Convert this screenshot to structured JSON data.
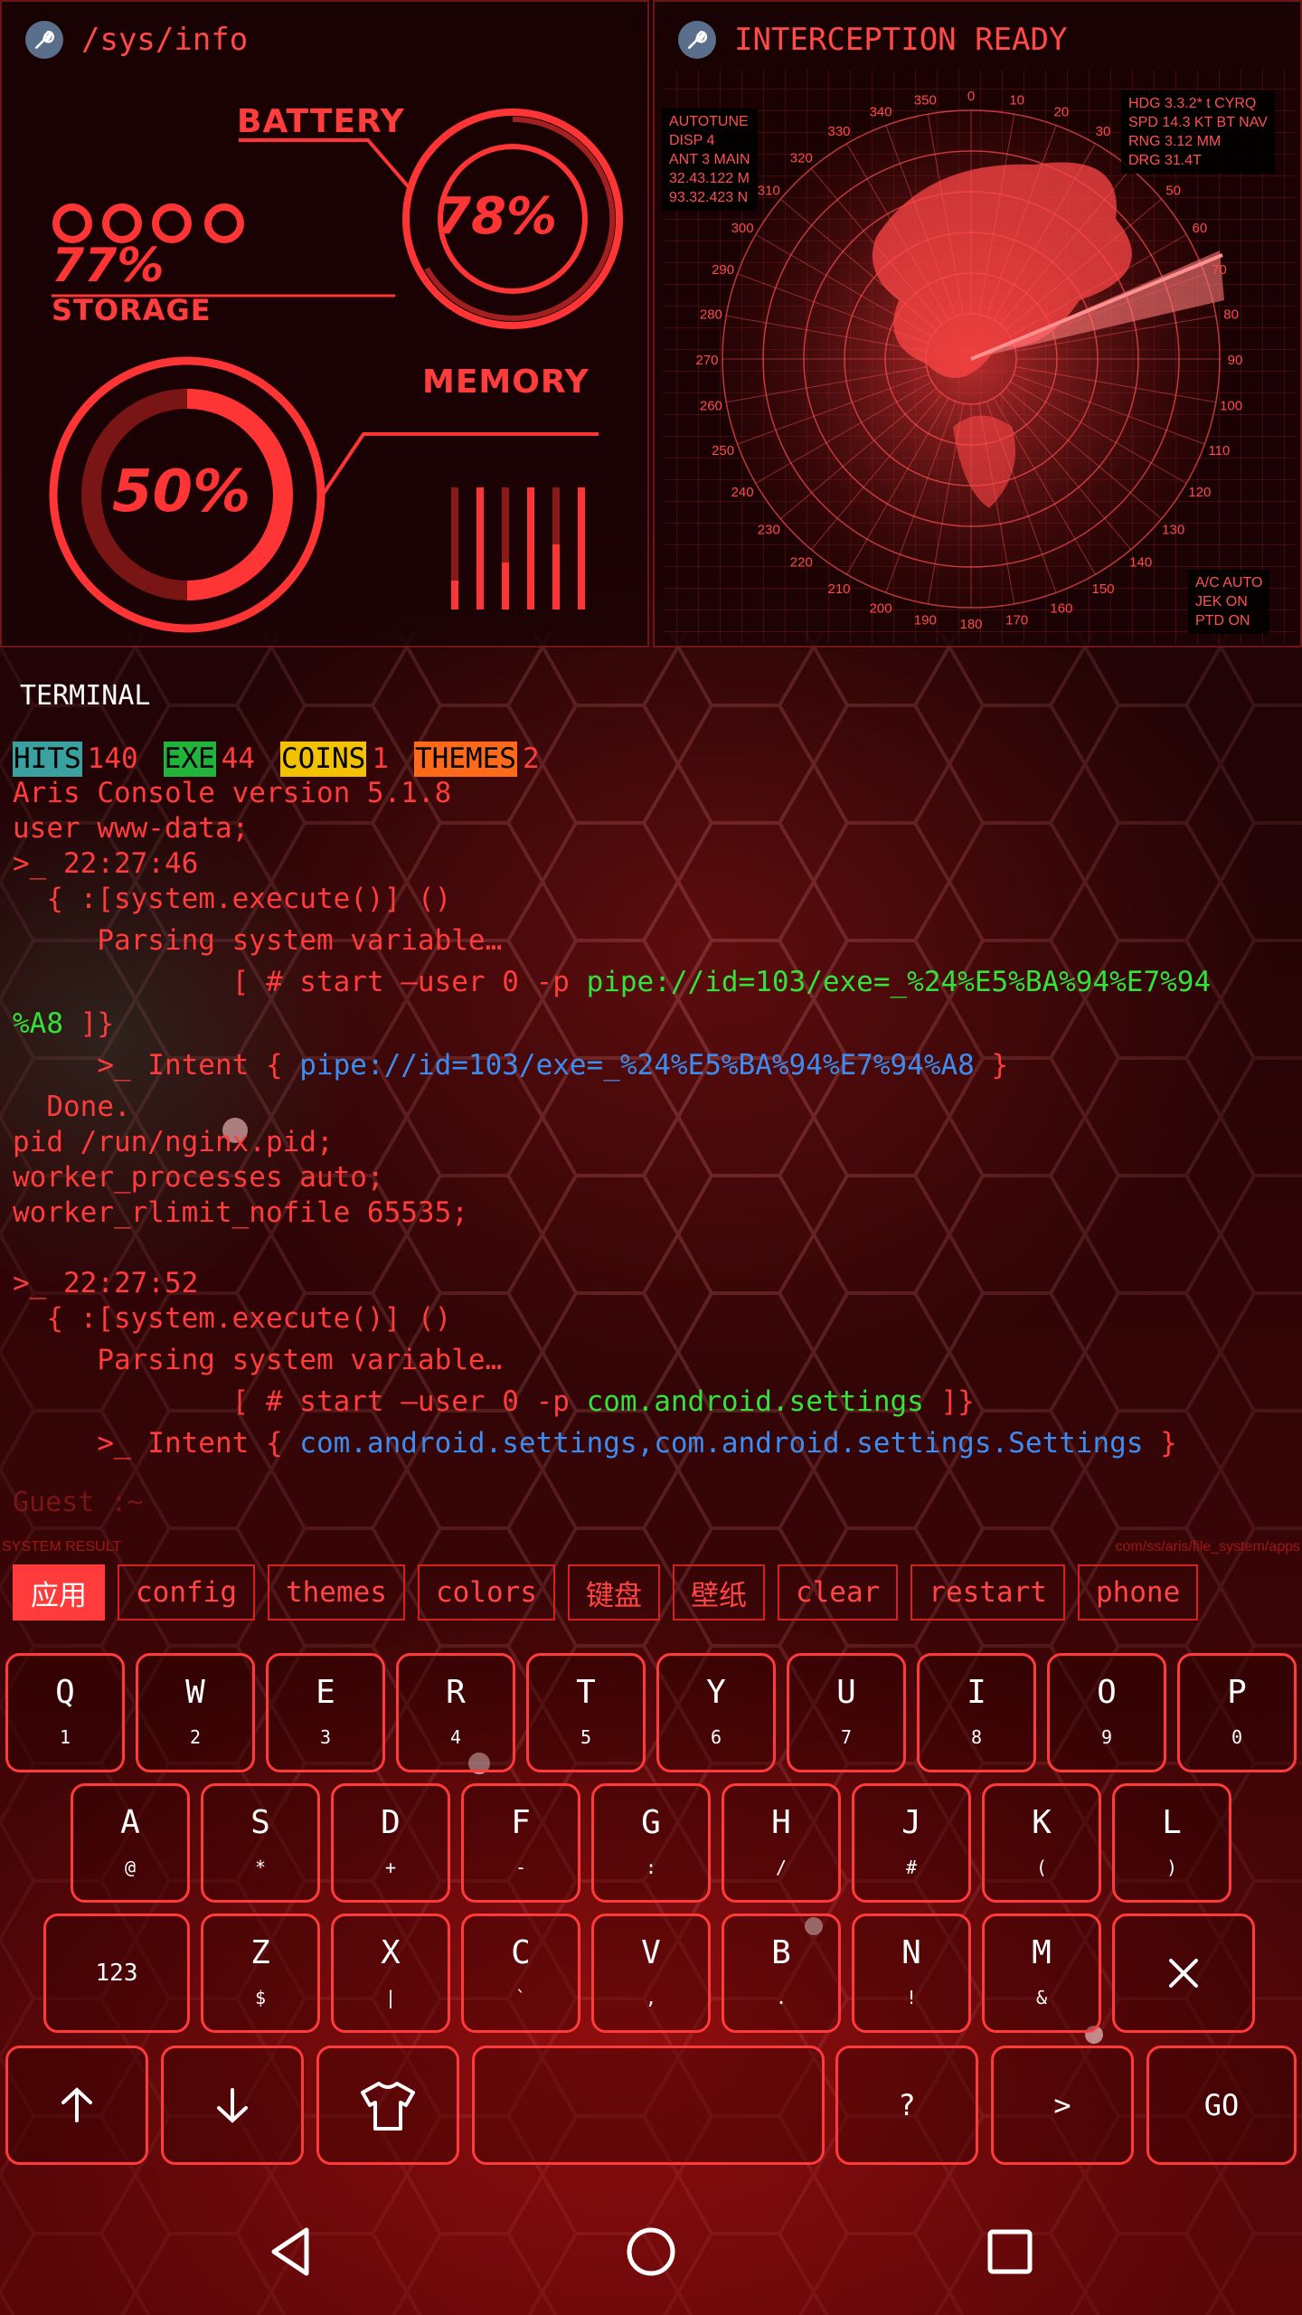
{
  "sys_panel": {
    "path": "/sys/info",
    "battery_label": "BATTERY",
    "battery_value": "78%",
    "battery_level": 0.78,
    "storage_value": "77%",
    "storage_label": "STORAGE",
    "memory_label": "MEMORY",
    "memory_value": "50%",
    "memory_level": 0.5
  },
  "radar_panel": {
    "title": "INTERCEPTION READY",
    "info_topleft": "AUTOTUNE\nDISP 4\nANT 3 MAIN\n32.43.122 M\n93.32.423 N",
    "info_topright": "HDG 3.3.2* t CYRQ\nSPD 14.3 KT BT NAV\nRNG 3.12 MM\nDRG 31.4T",
    "info_bottomright": "A/C AUTO\nJEK ON\nPTD ON",
    "bearings": [
      "350",
      "0",
      "10",
      "20",
      "30",
      "40",
      "50",
      "60",
      "70",
      "80",
      "90",
      "100",
      "110",
      "120",
      "130",
      "140",
      "150",
      "160",
      "170",
      "180",
      "190",
      "200",
      "210",
      "220",
      "230",
      "240",
      "250",
      "260",
      "270",
      "280",
      "290",
      "300",
      "310",
      "320",
      "330",
      "340"
    ]
  },
  "terminal": {
    "title": "TERMINAL",
    "stats": [
      {
        "tag": "HITS",
        "value": "140",
        "color": "#3aa0a0"
      },
      {
        "tag": "EXE",
        "value": "44",
        "color": "#22b33a"
      },
      {
        "tag": "COINS",
        "value": "1",
        "color": "#f2c200"
      },
      {
        "tag": "THEMES",
        "value": "2",
        "color": "#ff6a1a"
      }
    ],
    "line1": "Aris Console version 5.1.8",
    "line2": "user www-data;",
    "line3": ">_ 22:27:46",
    "line4": "  { :[system.execute()] ()",
    "line5": "     Parsing system variable…",
    "line6a": "             [ # start —user 0 -p ",
    "line6b": "pipe://id=103/exe=_%24%E5%BA%94%E7%94",
    "line7a": "%A8",
    "line7b": " ]}",
    "line8a": "     >_ Intent { ",
    "line8b": "pipe://id=103/exe=_%24%E5%BA%94%E7%94%A8",
    "line8c": " }",
    "line9": "  Done.",
    "line10": "pid /run/nginx.pid;",
    "line11": "worker_processes auto;",
    "line12": "worker_rlimit_nofile 65535;",
    "line13": ">_ 22:27:52",
    "line14": "  { :[system.execute()] ()",
    "line15": "     Parsing system variable…",
    "line16a": "             [ # start —user 0 -p ",
    "line16b": "com.android.settings",
    "line16c": " ]}",
    "line17a": "     >_ Intent { ",
    "line17b": "com.android.settings,com.android.settings.Settings",
    "line17c": " }",
    "prompt": "Guest :~"
  },
  "suggestions": {
    "left_label": "SYSTEM RESULT",
    "right_label": "com/ss/aris/file_system/apps",
    "chips": [
      "应用",
      "config",
      "themes",
      "colors",
      "键盘",
      "壁纸",
      "clear",
      "restart",
      "phone"
    ]
  },
  "keyboard": {
    "row1": [
      {
        "main": "Q",
        "sub": "1"
      },
      {
        "main": "W",
        "sub": "2"
      },
      {
        "main": "E",
        "sub": "3"
      },
      {
        "main": "R",
        "sub": "4"
      },
      {
        "main": "T",
        "sub": "5"
      },
      {
        "main": "Y",
        "sub": "6"
      },
      {
        "main": "U",
        "sub": "7"
      },
      {
        "main": "I",
        "sub": "8"
      },
      {
        "main": "O",
        "sub": "9"
      },
      {
        "main": "P",
        "sub": "0"
      }
    ],
    "row2": [
      {
        "main": "A",
        "sub": "@"
      },
      {
        "main": "S",
        "sub": "*"
      },
      {
        "main": "D",
        "sub": "+"
      },
      {
        "main": "F",
        "sub": "-"
      },
      {
        "main": "G",
        "sub": ":"
      },
      {
        "main": "H",
        "sub": "/"
      },
      {
        "main": "J",
        "sub": "#"
      },
      {
        "main": "K",
        "sub": "("
      },
      {
        "main": "L",
        "sub": ")"
      }
    ],
    "row3_numkey": "123",
    "row3": [
      {
        "main": "Z",
        "sub": "$"
      },
      {
        "main": "X",
        "sub": "|"
      },
      {
        "main": "C",
        "sub": "`"
      },
      {
        "main": "V",
        "sub": ","
      },
      {
        "main": "B",
        "sub": "."
      },
      {
        "main": "N",
        "sub": "!"
      },
      {
        "main": "M",
        "sub": "&"
      }
    ],
    "row4_question": "?",
    "row4_greater": ">",
    "row4_go": "GO"
  },
  "colors": {
    "accent": "#ff3b3b",
    "cmd_green": "#33e33a",
    "cmd_blue": "#3e8cf0"
  }
}
